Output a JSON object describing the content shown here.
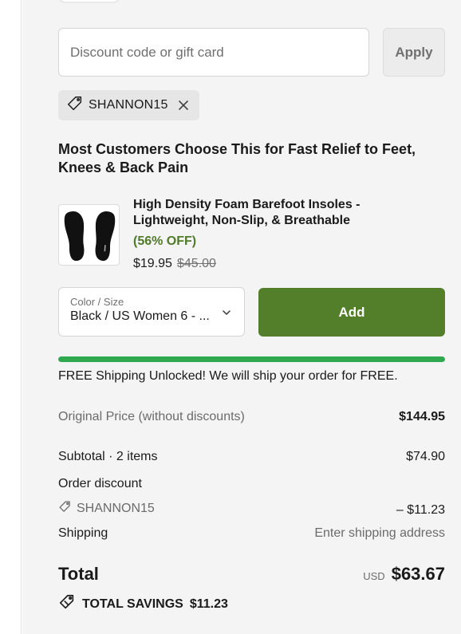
{
  "discount": {
    "placeholder": "Discount code or gift card",
    "apply_label": "Apply",
    "applied_code": "SHANNON15"
  },
  "upsell": {
    "title": "Most Customers Choose This for Fast Relief to Feet, Knees & Back Pain",
    "product": {
      "name": "High Density Foam Barefoot Insoles - Lightweight, Non-Slip, & Breathable",
      "discount_badge": "(56% OFF)",
      "price": "$19.95",
      "compare_price": "$45.00"
    },
    "variant": {
      "caption": "Color / Size",
      "value": "Black / US Women 6 - ..."
    },
    "add_label": "Add"
  },
  "shipping_progress": {
    "percent": 100,
    "message": "FREE Shipping Unlocked! We will ship your order for FREE."
  },
  "summary": {
    "original_price_label": "Original Price (without discounts)",
    "original_price_value": "$144.95",
    "subtotal_label": "Subtotal · 2 items",
    "subtotal_value": "$74.90",
    "order_discount_label": "Order discount",
    "order_discount_code": "SHANNON15",
    "order_discount_value": "– $11.23",
    "shipping_label": "Shipping",
    "shipping_value": "Enter shipping address",
    "total_label": "Total",
    "currency": "USD",
    "total_value": "$63.67",
    "savings_label": "TOTAL SAVINGS",
    "savings_value": "$11.23"
  },
  "colors": {
    "accent_green": "#547f2a",
    "progress_green": "#2fa84f",
    "discount_text_green": "#4f7a2a"
  },
  "icons": {
    "tag": "tag-icon",
    "close": "close-icon",
    "chevron": "chevron-down-icon",
    "savings": "savings-tag-icon"
  }
}
